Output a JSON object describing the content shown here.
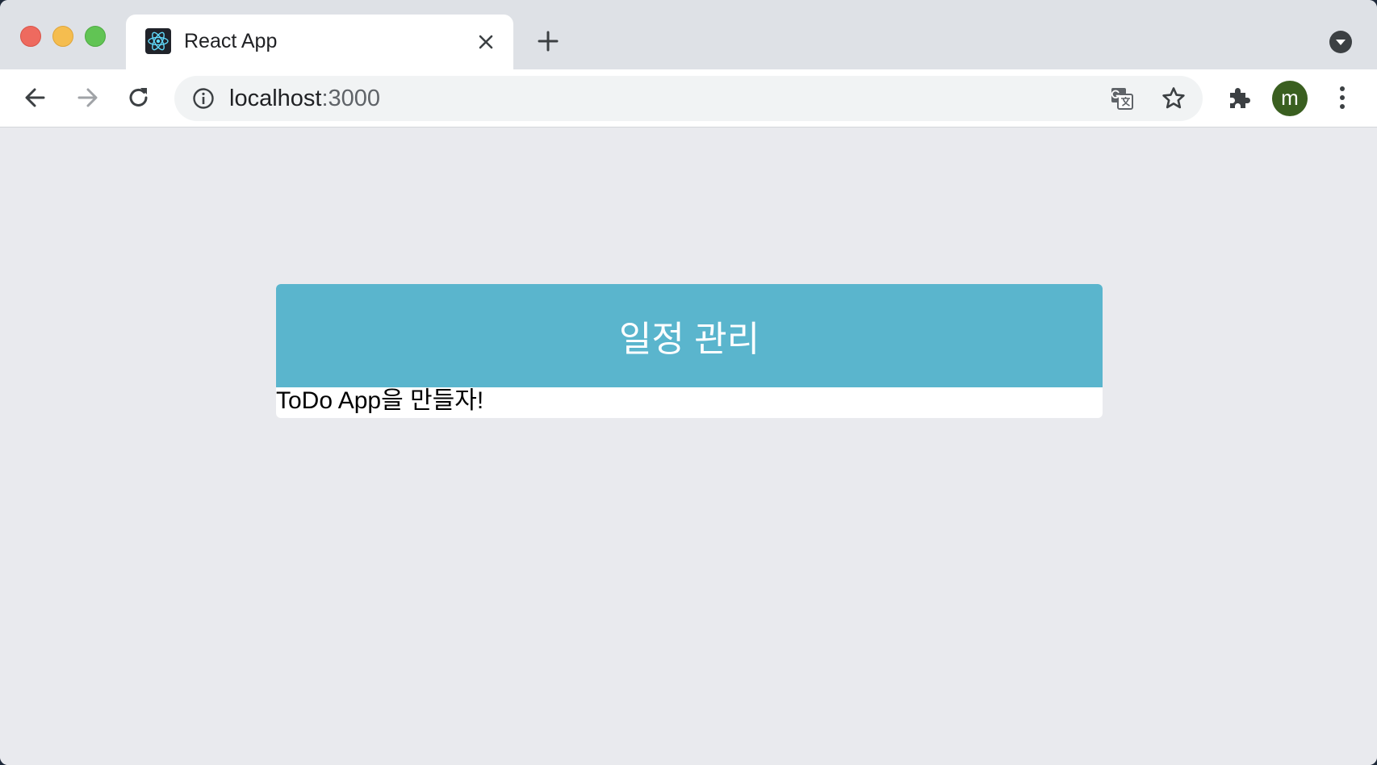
{
  "browser": {
    "tab": {
      "title": "React App",
      "favicon": "react-logo-icon"
    },
    "address_bar": {
      "host": "localhost",
      "port": ":3000"
    },
    "profile_initial": "m",
    "colors": {
      "tab_strip": "#dee1e6",
      "avatar": "#3a5f20"
    }
  },
  "app": {
    "header": "일정 관리",
    "content": "ToDo App을 만들자!",
    "colors": {
      "header_bg": "#5ab5cd",
      "page_bg": "#e9eaee"
    }
  }
}
